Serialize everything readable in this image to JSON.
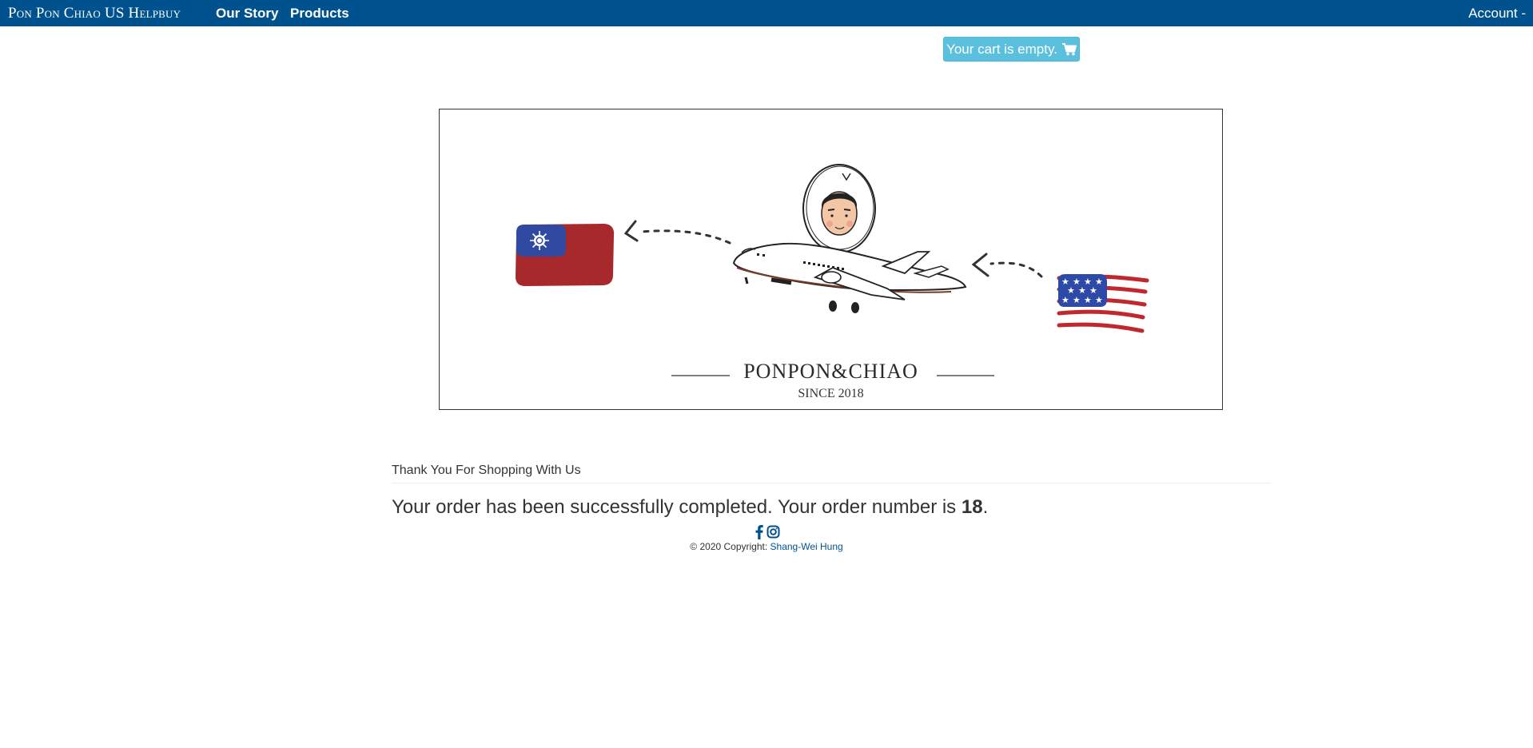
{
  "navbar": {
    "brand": "Pon Pon Chiao US Helpbuy",
    "links": [
      {
        "label": "Our Story"
      },
      {
        "label": "Products"
      }
    ],
    "account_label": "Account -"
  },
  "cart": {
    "label": "Your cart is empty.",
    "icon": "shopping-cart-icon"
  },
  "banner": {
    "title": "PONPON&CHIAO",
    "since": "SINCE 2018"
  },
  "main": {
    "heading": "Thank You For Shopping With Us",
    "message_prefix": "Your order has been successfully completed. Your order number is ",
    "order_number": "18",
    "message_suffix": "."
  },
  "footer": {
    "social_icons": [
      "facebook-icon",
      "instagram-icon"
    ],
    "copyright_prefix": "© 2020 Copyright: ",
    "author": "Shang-Wei Hung"
  },
  "colors": {
    "navbar": "#00528f",
    "cart_button": "#5bc0de",
    "link": "#00528f",
    "taiwan_red": "#a8292b",
    "taiwan_blue": "#2f4aa0",
    "us_red": "#c0282e",
    "us_blue": "#2d4aa8"
  }
}
